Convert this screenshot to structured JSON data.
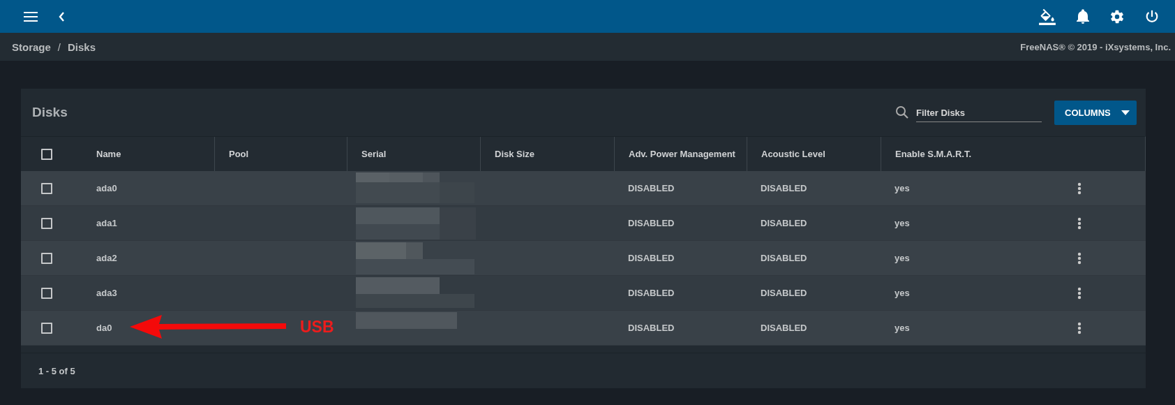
{
  "breadcrumb": {
    "items": [
      "Storage",
      "Disks"
    ],
    "separator": "/"
  },
  "copyright": "FreeNAS® © 2019 - iXsystems, Inc.",
  "card": {
    "title": "Disks",
    "filter": {
      "placeholder": "Filter Disks"
    },
    "columns_button": {
      "label": "COLUMNS"
    }
  },
  "table": {
    "header_checkbox": {
      "checked": false
    },
    "columns": [
      "Name",
      "Pool",
      "Serial",
      "Disk Size",
      "Adv. Power Management",
      "Acoustic Level",
      "Enable S.M.A.R.T."
    ],
    "rows": [
      {
        "checked": false,
        "name": "ada0",
        "apm": "DISABLED",
        "acoustic": "DISABLED",
        "smart": "yes"
      },
      {
        "checked": false,
        "name": "ada1",
        "apm": "DISABLED",
        "acoustic": "DISABLED",
        "smart": "yes"
      },
      {
        "checked": false,
        "name": "ada2",
        "apm": "DISABLED",
        "acoustic": "DISABLED",
        "smart": "yes"
      },
      {
        "checked": false,
        "name": "ada3",
        "apm": "DISABLED",
        "acoustic": "DISABLED",
        "smart": "yes"
      },
      {
        "checked": false,
        "name": "da0",
        "apm": "DISABLED",
        "acoustic": "DISABLED",
        "smart": "yes",
        "annotation": "USB"
      }
    ],
    "pagination": "1 - 5 of 5"
  }
}
